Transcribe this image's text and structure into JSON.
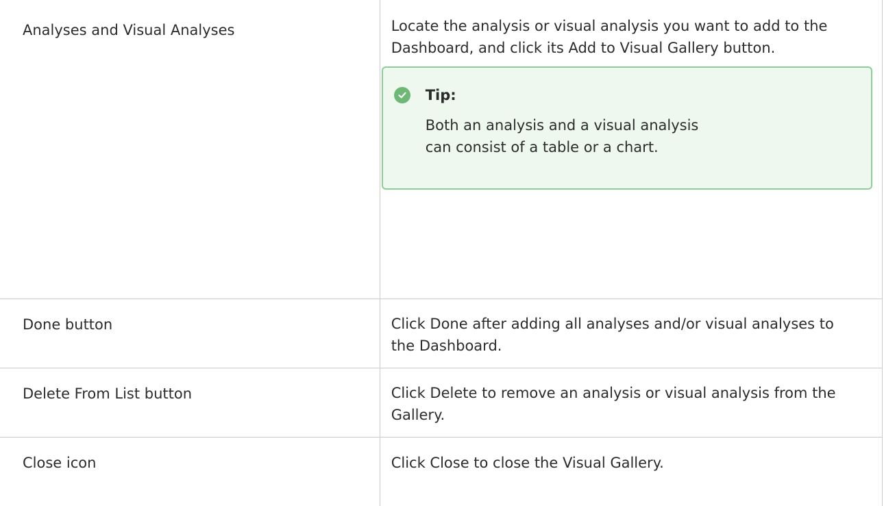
{
  "rows": [
    {
      "term": "Analyses and Visual Analyses",
      "description": "Locate the analysis or visual analysis you want to add to the Dashboard, and click its Add to Visual Gallery button.",
      "tip": {
        "title": "Tip:",
        "body": "Both an analysis and a visual analysis can consist of a table or a chart.",
        "icon": "check-circle-icon",
        "icon_color": "#6cb874",
        "border_color": "#8ccf95",
        "background_color": "#eef8ef"
      }
    },
    {
      "term": "Done button",
      "description": "Click Done after adding all analyses and/or visual analyses to the Dashboard."
    },
    {
      "term": "Delete From List button",
      "description": "Click Delete to remove an analysis or visual analysis from the Gallery."
    },
    {
      "term": "Close icon",
      "description": "Click Close to close the Visual Gallery."
    }
  ]
}
